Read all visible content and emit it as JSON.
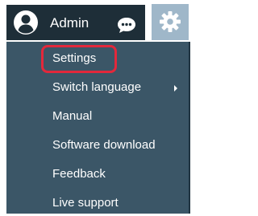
{
  "header": {
    "user_name": "Admin",
    "avatar_icon": "user-circle-icon",
    "chat_icon": "chat-bubble-icon",
    "settings_icon": "gear-icon"
  },
  "menu": {
    "items": [
      {
        "label": "Settings"
      },
      {
        "label": "Switch language",
        "has_submenu": true
      },
      {
        "label": "Manual"
      },
      {
        "label": "Software download"
      },
      {
        "label": "Feedback"
      },
      {
        "label": "Live support"
      }
    ]
  },
  "colors": {
    "header_bg": "#1e2e38",
    "gear_bg": "#9fb7c9",
    "menu_bg": "#3b5667",
    "highlight": "#e3283b"
  }
}
